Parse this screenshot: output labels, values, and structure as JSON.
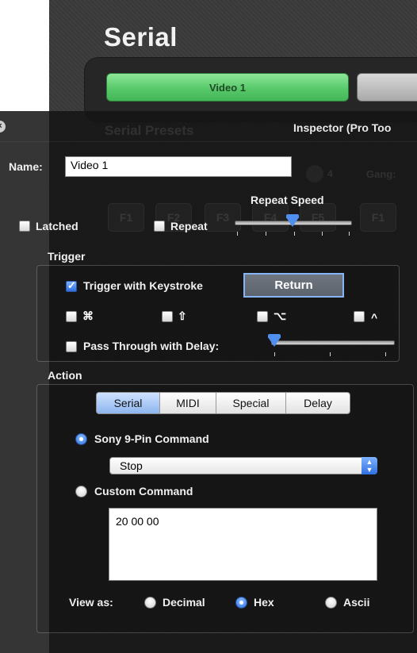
{
  "background_app": {
    "title": "Serial",
    "preset_button_label": "Video 1",
    "ghost_section_label": "Serial Presets",
    "ghost_number": "4",
    "ghost_gang": "Gang:",
    "ghost_keys": [
      "F1",
      "F2",
      "F3",
      "F4",
      "F5",
      "F1"
    ]
  },
  "inspector": {
    "title": "Inspector (Pro Too",
    "name_label": "Name:",
    "name_value": "Video 1",
    "latched_label": "Latched",
    "latched_checked": false,
    "repeat_label": "Repeat",
    "repeat_checked": false,
    "repeat_speed_label": "Repeat Speed",
    "repeat_speed_fraction": 0.5,
    "trigger": {
      "section_label": "Trigger",
      "keystroke_label": "Trigger with Keystroke",
      "keystroke_checked": true,
      "key_value": "Return",
      "modifiers": [
        {
          "symbol": "⌘",
          "icon": "command-icon",
          "checked": false
        },
        {
          "symbol": "⇧",
          "icon": "shift-icon",
          "checked": false
        },
        {
          "symbol": "⌥",
          "icon": "option-icon",
          "checked": false
        },
        {
          "symbol": "^",
          "icon": "control-icon",
          "checked": false
        }
      ],
      "pass_through_label": "Pass Through with Delay:",
      "pass_through_checked": false,
      "delay_fraction": 0.0
    },
    "action": {
      "section_label": "Action",
      "tabs": [
        {
          "label": "Serial",
          "active": true
        },
        {
          "label": "MIDI",
          "active": false
        },
        {
          "label": "Special",
          "active": false
        },
        {
          "label": "Delay",
          "active": false
        }
      ],
      "sony_label": "Sony 9-Pin Command",
      "sony_selected": true,
      "sony_command_value": "Stop",
      "custom_label": "Custom Command",
      "custom_selected": false,
      "custom_command_value": "20 00 00",
      "view_as_label": "View as:",
      "view_as_options": [
        {
          "label": "Decimal",
          "selected": false
        },
        {
          "label": "Hex",
          "selected": true
        },
        {
          "label": "Ascii",
          "selected": false
        }
      ]
    }
  },
  "colors": {
    "accent_blue": "#2f6fe0",
    "preset_green": "#58c96a",
    "inspector_bg": "#1e1e1e"
  }
}
